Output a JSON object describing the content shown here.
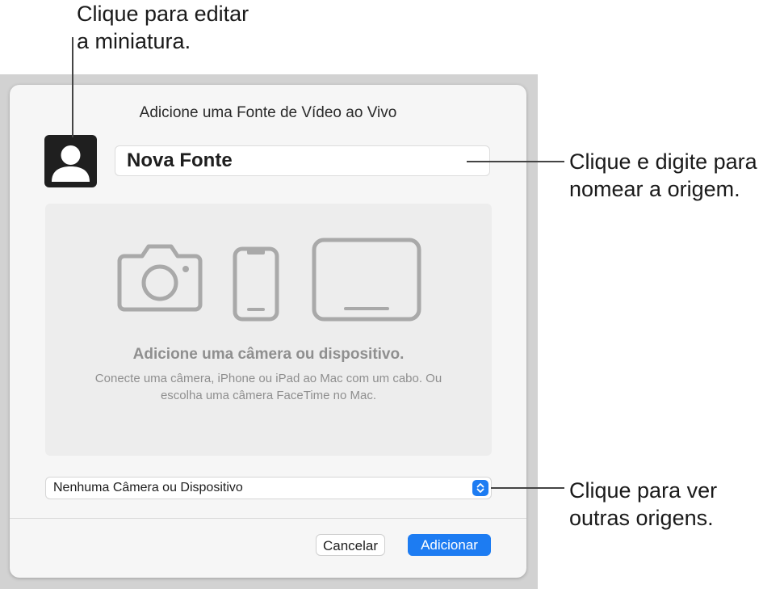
{
  "callouts": {
    "thumbnail": "Clique para editar\na miniatura.",
    "name": "Clique e digite para\nnomear a origem.",
    "sources": "Clique para ver\noutras origens."
  },
  "dialog": {
    "title": "Adicione uma Fonte de Vídeo ao Vivo",
    "name_value": "Nova Fonte",
    "drop_heading": "Adicione uma câmera ou dispositivo.",
    "drop_description": "Conecte uma câmera, iPhone ou iPad ao Mac com um cabo. Ou escolha uma câmera FaceTime no Mac.",
    "source_selected": "Nenhuma Câmera ou Dispositivo",
    "cancel_label": "Cancelar",
    "add_label": "Adicionar"
  },
  "icons": {
    "thumbnail": "person-silhouette-icon",
    "camera": "camera-icon",
    "phone": "iphone-icon",
    "tablet": "ipad-icon",
    "stepper": "chevron-up-down-icon"
  },
  "colors": {
    "accent": "#1d7cf2",
    "sheet": "#f6f6f6",
    "drop_area": "#ededed",
    "placeholder_icons": "#a9a9a9"
  }
}
